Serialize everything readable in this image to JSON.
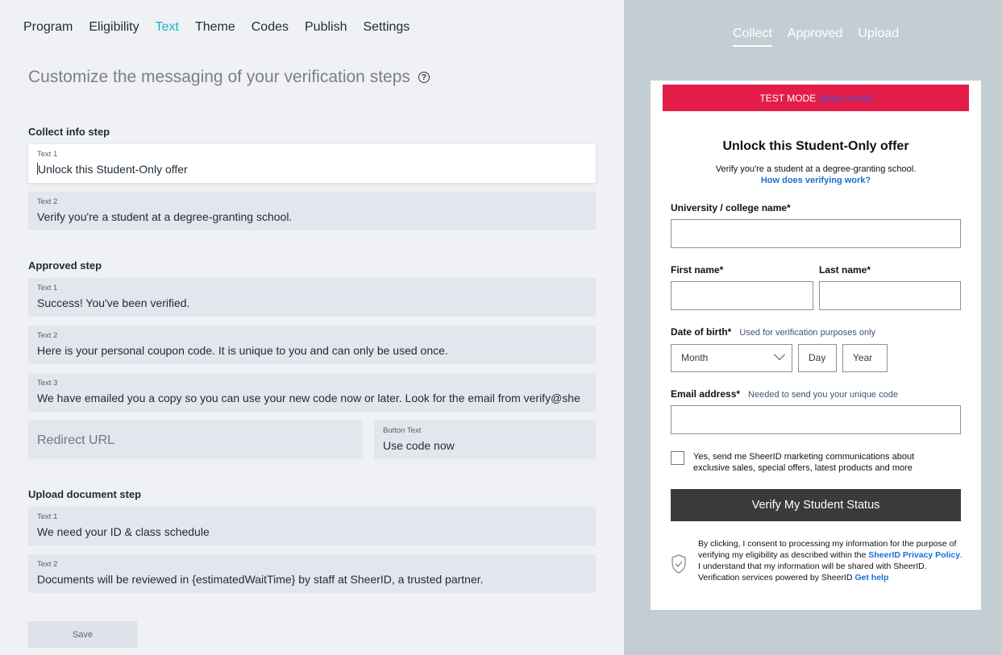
{
  "nav": {
    "items": [
      "Program",
      "Eligibility",
      "Text",
      "Theme",
      "Codes",
      "Publish",
      "Settings"
    ],
    "active": "Text"
  },
  "heading": "Customize the messaging of your verification steps",
  "help_icon": "?",
  "collect": {
    "title": "Collect info step",
    "text1_label": "Text 1",
    "text1_value": "Unlock this Student-Only offer",
    "text2_label": "Text 2",
    "text2_value": "Verify you're a student at a degree-granting school."
  },
  "approved": {
    "title": "Approved step",
    "text1_label": "Text 1",
    "text1_value": "Success! You've been verified.",
    "text2_label": "Text 2",
    "text2_value": "Here is your personal coupon code. It is unique to you and can only be used once.",
    "text3_label": "Text 3",
    "text3_value": "We have emailed you a copy so you can use your new code now or later. Look for the email from verify@she",
    "redirect_placeholder": "Redirect URL",
    "button_text_label": "Button Text",
    "button_text_value": "Use code now"
  },
  "upload": {
    "title": "Upload document step",
    "text1_label": "Text 1",
    "text1_value": "We need your ID & class schedule",
    "text2_label": "Text 2",
    "text2_value": "Documents will be reviewed in {estimatedWaitTime} by staff at SheerID, a trusted partner."
  },
  "save_label": "Save",
  "preview": {
    "tabs": [
      "Collect",
      "Approved",
      "Upload"
    ],
    "active_tab": "Collect",
    "test_mode": "TEST MODE",
    "learn_more": "(learn more)",
    "title": "Unlock this Student-Only offer",
    "subtitle": "Verify you're a student at a degree-granting school.",
    "how_link": "How does verifying work?",
    "university_label": "University / college name*",
    "first_name_label": "First name*",
    "last_name_label": "Last name*",
    "dob_label": "Date of birth*",
    "dob_hint": "Used for verification purposes only",
    "month_placeholder": "Month",
    "day_placeholder": "Day",
    "year_placeholder": "Year",
    "email_label": "Email address*",
    "email_hint": "Needed to send you your unique code",
    "marketing_text": "Yes, send me SheerID marketing communications about exclusive sales, special offers, latest products and more",
    "verify_button": "Verify My Student Status",
    "consent_1": "By clicking, I consent to processing my information for the purpose of verifying my eligibility as described within the",
    "consent_link": "SheerID Privacy Policy",
    "consent_2": ". I understand that my information will be shared with SheerID.",
    "powered_by": "Verification services powered by SheerID",
    "get_help": "Get help"
  },
  "colors": {
    "accent": "#1ab0c6",
    "test_bar": "#e41d48",
    "link": "#1a6fd6",
    "verify_button": "#3a3a3a"
  }
}
